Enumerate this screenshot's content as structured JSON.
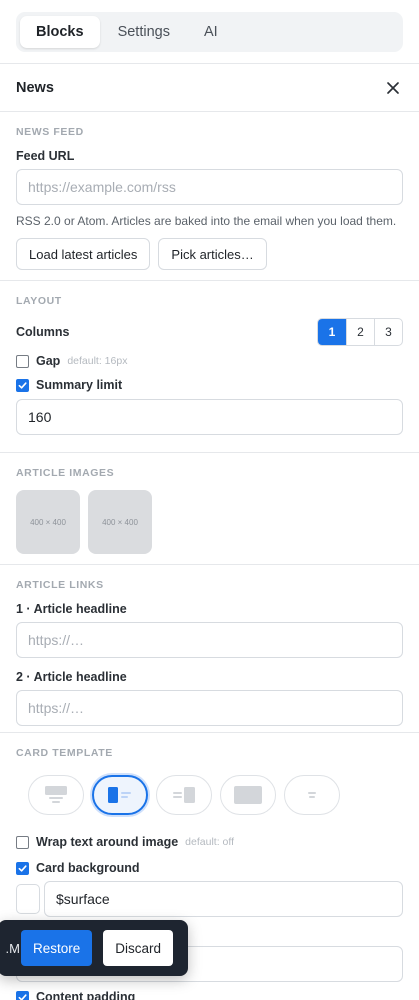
{
  "tabs": [
    {
      "label": "Blocks",
      "active": true
    },
    {
      "label": "Settings",
      "active": false
    },
    {
      "label": "AI",
      "active": false
    }
  ],
  "panel": {
    "title": "News",
    "close_icon": "close-icon"
  },
  "news_feed": {
    "section_title": "NEWS FEED",
    "feed_url_label": "Feed URL",
    "feed_url_value": "",
    "feed_url_placeholder": "https://example.com/rss",
    "hint": "RSS 2.0 or Atom. Articles are baked into the email when you load them.",
    "load_button": "Load latest articles",
    "pick_button": "Pick articles…"
  },
  "layout": {
    "section_title": "LAYOUT",
    "columns_label": "Columns",
    "column_options": [
      "1",
      "2",
      "3"
    ],
    "selected_column": "1",
    "gap_label": "Gap",
    "gap_default": "default: 16px",
    "gap_checked": false,
    "summary_limit_label": "Summary limit",
    "summary_limit_checked": true,
    "summary_limit_value": "160"
  },
  "article_images": {
    "section_title": "ARTICLE IMAGES",
    "images": [
      {
        "label": "400 × 400"
      },
      {
        "label": "400 × 400"
      }
    ]
  },
  "article_links": {
    "section_title": "ARTICLE LINKS",
    "links": [
      {
        "label": "1 · Article headline",
        "value": "",
        "placeholder": "https://…"
      },
      {
        "label": "2 · Article headline",
        "value": "",
        "placeholder": "https://…"
      }
    ]
  },
  "card_template": {
    "section_title": "CARD TEMPLATE",
    "templates": [
      {
        "icon": "image-top-template-icon",
        "active": false
      },
      {
        "icon": "image-left-template-icon",
        "active": true
      },
      {
        "icon": "image-right-template-icon",
        "active": false
      },
      {
        "icon": "image-only-template-icon",
        "active": false
      },
      {
        "icon": "text-only-template-icon",
        "active": false
      }
    ],
    "wrap_label": "Wrap text around image",
    "wrap_default": "default: off",
    "wrap_checked": false,
    "card_bg_label": "Card background",
    "card_bg_checked": true,
    "card_bg_value": "$surface",
    "content_padding_label": "Content padding",
    "content_padding_checked": true
  },
  "toast": {
    "message_fragment": "M.",
    "restore_label": "Restore",
    "discard_label": "Discard"
  },
  "colors": {
    "accent": "#1a73e8",
    "toast_bg": "#1e2530",
    "border": "#d7dbe0",
    "placeholder_thumb": "#dadcdf"
  }
}
